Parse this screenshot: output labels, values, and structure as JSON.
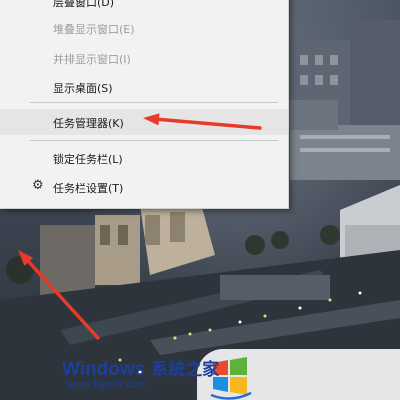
{
  "context_menu": {
    "items": [
      {
        "label": "层叠窗口(D)",
        "enabled": true
      },
      {
        "label": "堆叠显示窗口(E)",
        "enabled": false
      },
      {
        "label": "并排显示窗口(I)",
        "enabled": false
      },
      {
        "label": "显示桌面(S)",
        "enabled": true
      },
      {
        "label": "任务管理器(K)",
        "enabled": true,
        "highlighted": true
      },
      {
        "label": "锁定任务栏(L)",
        "enabled": true
      },
      {
        "label": "任务栏设置(T)",
        "enabled": true,
        "icon": "gear-icon"
      }
    ]
  },
  "annotations": {
    "arrow_color": "#e8392b"
  },
  "watermark": {
    "brand": "Windows",
    "brand_cn": "系统之家",
    "url": "www.bjjmlv.com",
    "logo": "windows-logo"
  }
}
